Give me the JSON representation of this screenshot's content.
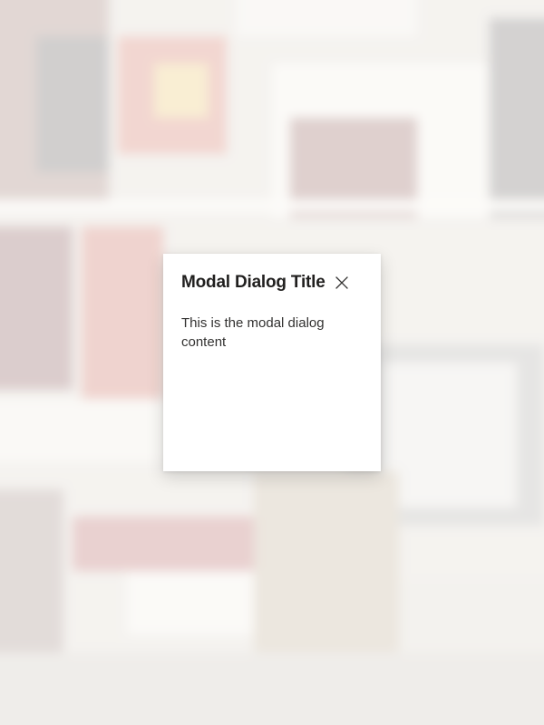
{
  "modal": {
    "title": "Modal Dialog Title",
    "content": "This is the modal dialog content",
    "close_icon": "close-icon"
  }
}
